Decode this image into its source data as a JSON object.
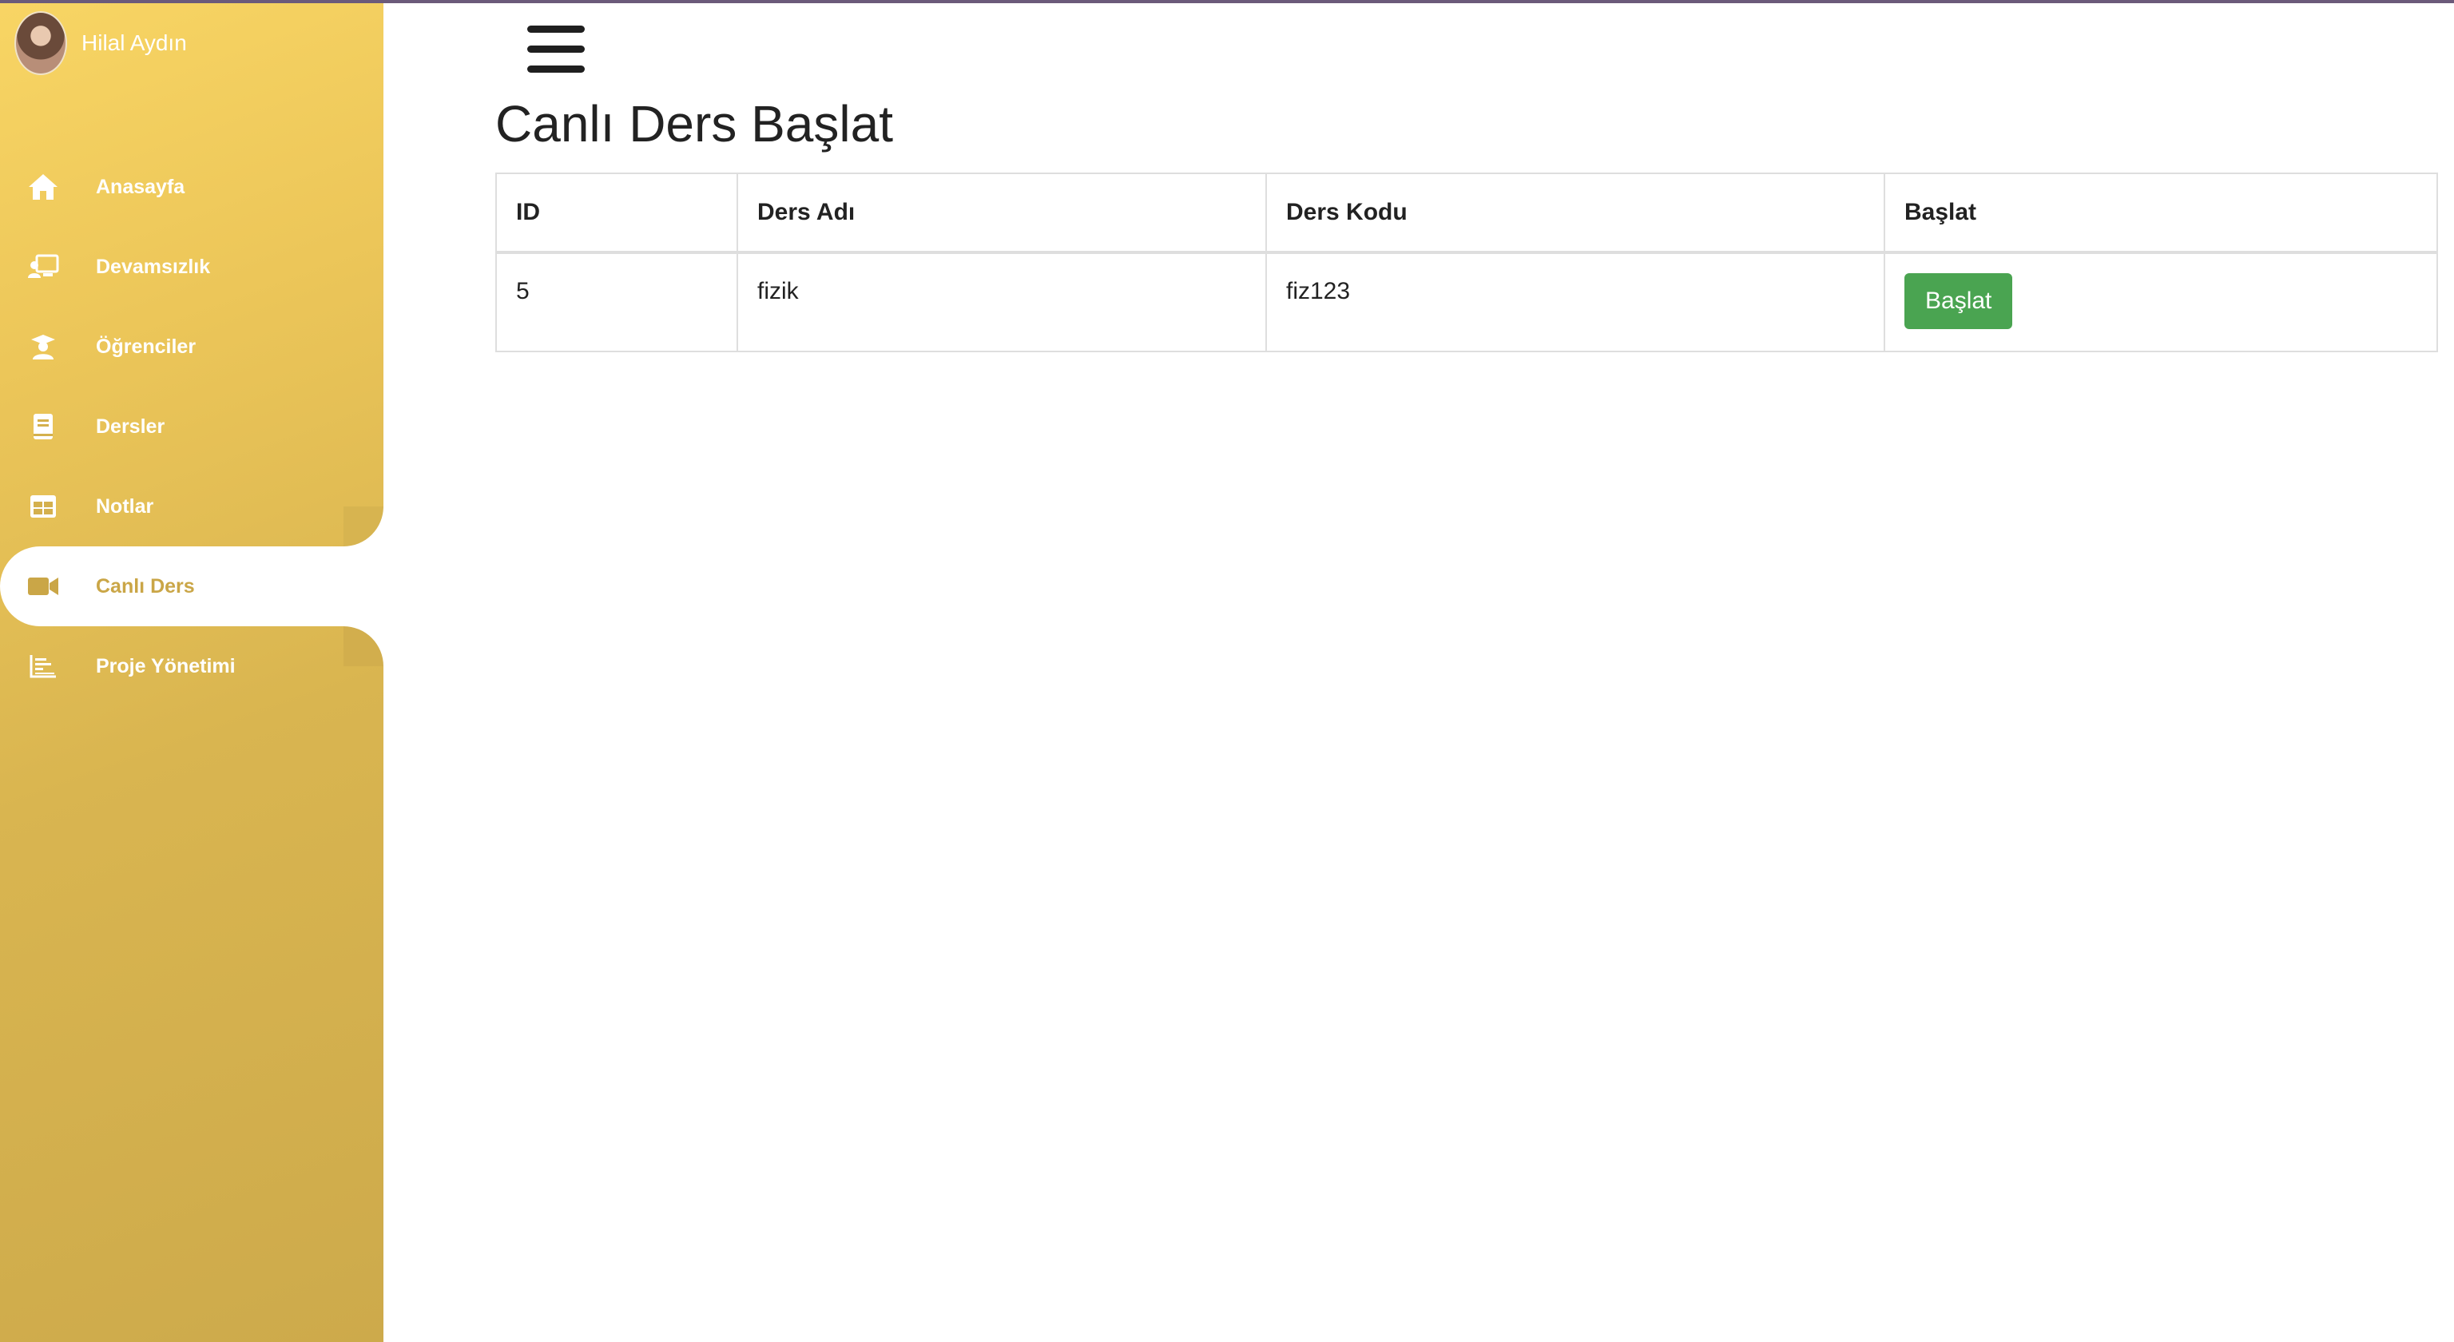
{
  "user": {
    "name": "Hilal Aydın"
  },
  "sidebar": {
    "items": [
      {
        "label": "Anasayfa",
        "icon": "home-icon"
      },
      {
        "label": "Devamsızlık",
        "icon": "attendance-icon"
      },
      {
        "label": "Öğrenciler",
        "icon": "students-icon"
      },
      {
        "label": "Dersler",
        "icon": "book-icon"
      },
      {
        "label": "Notlar",
        "icon": "grades-table-icon"
      },
      {
        "label": "Canlı Ders",
        "icon": "video-camera-icon",
        "active": true
      },
      {
        "label": "Proje Yönetimi",
        "icon": "bar-chart-icon"
      }
    ]
  },
  "header": {
    "menu_icon": "hamburger-menu-icon"
  },
  "main": {
    "title": "Canlı Ders Başlat",
    "table": {
      "headers": [
        "ID",
        "Ders Adı",
        "Ders Kodu",
        "Başlat"
      ],
      "rows": [
        {
          "id": "5",
          "name": "fizik",
          "code": "fiz123",
          "action_label": "Başlat"
        }
      ]
    }
  },
  "colors": {
    "sidebar_gradient_start": "#f8d564",
    "sidebar_gradient_end": "#cdaa4b",
    "active_text": "#caa647",
    "start_button": "#4aa451"
  }
}
